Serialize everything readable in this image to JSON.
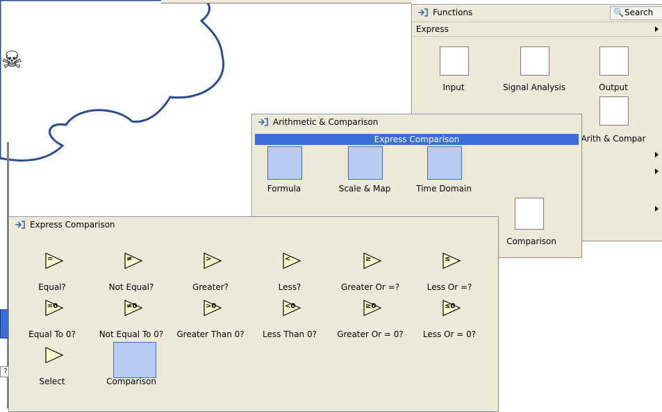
{
  "functions": {
    "title": "Functions",
    "search_label": "Search",
    "category": "Express",
    "items": [
      {
        "label": "Input"
      },
      {
        "label": "Signal Analysis"
      },
      {
        "label": "Output"
      },
      {
        "label": "Arith & Compar"
      }
    ]
  },
  "arith": {
    "title": "Arithmetic & Comparison",
    "header": "Express Comparison",
    "items": [
      {
        "label": "Formula"
      },
      {
        "label": "Scale & Map"
      },
      {
        "label": "Time Domain"
      },
      {
        "label": "Comparison"
      }
    ]
  },
  "express": {
    "title": "Express Comparison",
    "items": [
      {
        "label": "Equal?",
        "glyph": "="
      },
      {
        "label": "Not Equal?",
        "glyph": "≠"
      },
      {
        "label": "Greater?",
        "glyph": ">"
      },
      {
        "label": "Less?",
        "glyph": "<"
      },
      {
        "label": "Greater Or =?",
        "glyph": "≥"
      },
      {
        "label": "Less Or =?",
        "glyph": "≤"
      },
      {
        "label": "Equal To 0?",
        "glyph": "=0"
      },
      {
        "label": "Not Equal To 0?",
        "glyph": "≠0"
      },
      {
        "label": "Greater Than 0?",
        "glyph": ">0"
      },
      {
        "label": "Less Than 0?",
        "glyph": "<0"
      },
      {
        "label": "Greater Or = 0?",
        "glyph": "≥0"
      },
      {
        "label": "Less Or = 0?",
        "glyph": "≤0"
      },
      {
        "label": "Select",
        "glyph": ""
      },
      {
        "label": "Comparison",
        "glyph": ""
      }
    ]
  },
  "colors": {
    "selection": "#3b6fd6",
    "panel": "#ece9d8",
    "cloud_stroke": "#2a4b8d"
  },
  "icons": [
    "pin-icon",
    "search-icon",
    "skull-icon",
    "submenu-arrow-icon",
    "help-icon"
  ]
}
